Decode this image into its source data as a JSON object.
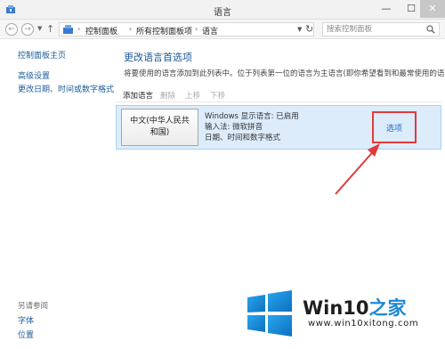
{
  "window": {
    "title": "语言",
    "minimize": "—",
    "maximize": "☐",
    "close": "✕"
  },
  "address": {
    "back": "←",
    "forward": "→",
    "up": "↑",
    "crumbs": [
      "控制面板",
      "所有控制面板项",
      "语言"
    ],
    "separator": "›",
    "refresh": "↻",
    "search_placeholder": "搜索控制面板"
  },
  "sidebar": {
    "home": "控制面板主页",
    "items": [
      "高级设置",
      "更改日期、时间或数字格式"
    ],
    "see_also_heading": "另请参阅",
    "see_also": [
      "字体",
      "位置"
    ]
  },
  "main": {
    "title": "更改语言首选项",
    "description": "将要使用的语言添加到此列表中。位于列表第一位的语言为主语言(即你希望看到和最常使用的语言)。",
    "toolbar": {
      "add": "添加语言",
      "remove": "删除",
      "move_up": "上移",
      "move_down": "下移"
    },
    "language": {
      "name_line1": "中文(中华人民共",
      "name_line2": "和国)",
      "display": "Windows 显示语言: 已启用",
      "input": "输入法: 微软拼音",
      "format": "日期、时间和数字格式",
      "options": "选项"
    }
  },
  "watermark": {
    "brand": "Win10",
    "brand_zh": "之家",
    "url": "www.win10xitong.com"
  },
  "colors": {
    "link": "#1a5c9c",
    "selection": "#dcecfb",
    "highlight": "#e03b3b",
    "brand_blue": "#1d88d4"
  }
}
